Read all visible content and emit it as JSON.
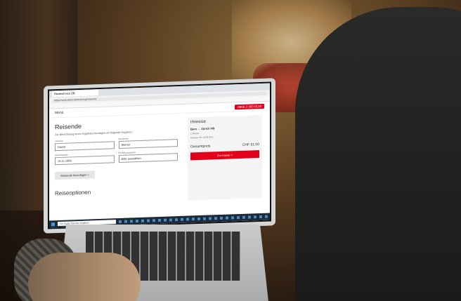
{
  "browser": {
    "tab_label": "Reiseservice DB",
    "address": "https://www.bahn.de/buchung/reisende"
  },
  "site": {
    "menu_label": "Menü",
    "phone_label": "0800 2 000 0128"
  },
  "form": {
    "title": "Reisende",
    "intro": "Zur Berechnung eines Angebots benötigen wir folgende Angaben:",
    "first_name_label": "Vorname",
    "first_name_value": "Daniel",
    "last_name_label": "Nachname",
    "last_name_value": "Steiner",
    "birth_label": "Geburtsdatum",
    "birth_value": "15.11.1988",
    "discount_label": "Ermäßigungskarte",
    "discount_value": "Bitte auswählen",
    "add_traveler_label": "Reisende hinzufügen  +",
    "next_section": "Reiseoptionen"
  },
  "summary": {
    "title": "Hinreise",
    "route": "Bern  →  Zürich HB",
    "line1": "1 Person",
    "line2": "Hinreise: Mi. 15.08.2021",
    "total_label": "Gesamtpreis",
    "total_value": "CHF 51.00",
    "pay_label": "Zur Kasse  >"
  },
  "taskbar": {
    "search_placeholder": "Zur Suche Text hier eingeben"
  }
}
